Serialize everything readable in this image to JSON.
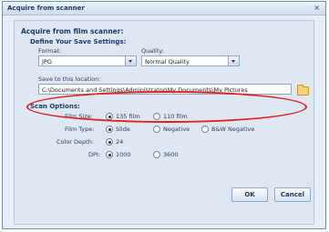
{
  "dialog": {
    "title": "Acquire from scanner",
    "close_glyph": "×"
  },
  "section": {
    "heading": "Acquire from film scanner:",
    "save_settings": {
      "heading": "Define Your Save Settings:",
      "format_label": "Format:",
      "format_value": "JPG",
      "quality_label": "Quality:",
      "quality_value": "Normal Quality",
      "location_label": "Save to this location:",
      "location_value": "C:\\Documents and Settings\\Administrator\\My Documents\\My Pictures"
    },
    "scan_options": {
      "heading": "Scan Options:",
      "film_size": {
        "label": "Film Size:",
        "options": [
          "135 film",
          "110 film"
        ],
        "selected": 0
      },
      "film_type": {
        "label": "Film Type:",
        "options": [
          "Slide",
          "Negative",
          "B&W Negative"
        ],
        "selected": 0
      },
      "color_depth": {
        "label": "Color Depth:",
        "options": [
          "24"
        ],
        "selected": 0
      },
      "dpi": {
        "label": "DPI:",
        "options": [
          "1000",
          "3600"
        ],
        "selected": 0
      }
    }
  },
  "buttons": {
    "ok": "OK",
    "cancel": "Cancel"
  },
  "icons": {
    "folder": "folder-icon",
    "close": "close-icon"
  },
  "colors": {
    "highlight": "#e3201b",
    "accent": "#1c3763"
  }
}
